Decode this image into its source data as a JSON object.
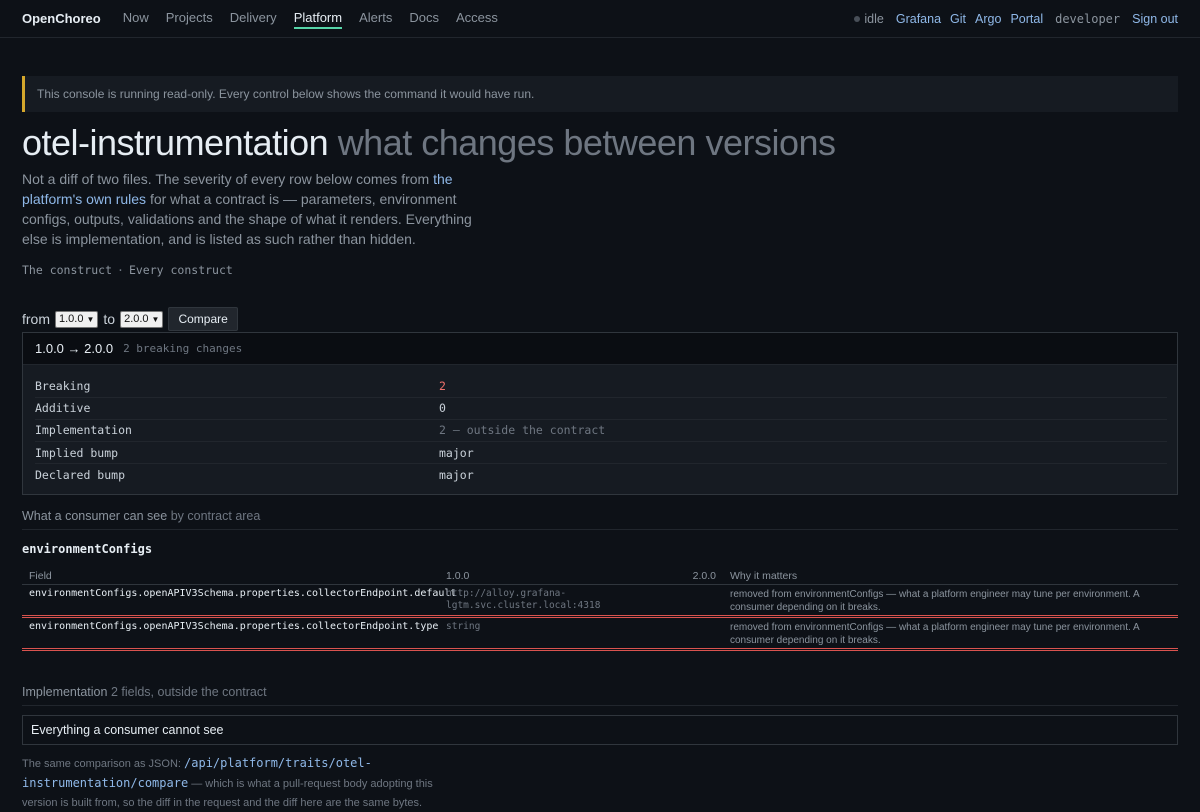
{
  "nav": {
    "brand": "OpenChoreo",
    "links": [
      "Now",
      "Projects",
      "Delivery",
      "Platform",
      "Alerts",
      "Docs",
      "Access"
    ],
    "active": "Platform",
    "status": "idle",
    "external": [
      "Grafana",
      "Git",
      "Argo",
      "Portal"
    ],
    "user": "developer",
    "signout": "Sign out"
  },
  "banner": "This console is running read-only. Every control below shows the command it would have run.",
  "title": {
    "main": "otel-instrumentation",
    "sub": "what changes between versions"
  },
  "intro": {
    "before": "Not a diff of two files. The severity of every row below comes from ",
    "link": "the platform's own rules",
    "after": " for what a contract is — parameters, environment configs, outputs, validations and the shape of what it renders. Everything else is implementation, and is listed as such rather than hidden."
  },
  "crumbs": [
    "The construct",
    "Every construct"
  ],
  "controls": {
    "from_label": "from",
    "from_value": "1.0.0",
    "to_label": "to",
    "to_value": "2.0.0",
    "compare": "Compare"
  },
  "summary": {
    "range": "1.0.0 → 2.0.0",
    "note": "2 breaking changes",
    "rows": [
      {
        "key": "Breaking",
        "value": "2"
      },
      {
        "key": "Additive",
        "value": "0"
      },
      {
        "key": "Implementation",
        "value": "2 — outside the contract"
      },
      {
        "key": "Implied bump",
        "value": "major"
      },
      {
        "key": "Declared bump",
        "value": "major"
      }
    ]
  },
  "consumer": {
    "label": "What a consumer can see",
    "dim": "by contract area"
  },
  "area": "environmentConfigs",
  "diff": {
    "headers": {
      "field": "Field",
      "v1": "1.0.0",
      "v2": "2.0.0",
      "why": "Why it matters"
    },
    "rows": [
      {
        "field": "environmentConfigs.openAPIV3Schema.properties.collectorEndpoint.default",
        "v1": "http://alloy.grafana-lgtm.svc.cluster.local:4318",
        "v2": "",
        "why": "removed from environmentConfigs — what a platform engineer may tune per environment. A consumer depending on it breaks."
      },
      {
        "field": "environmentConfigs.openAPIV3Schema.properties.collectorEndpoint.type",
        "v1": "string",
        "v2": "",
        "why": "removed from environmentConfigs — what a platform engineer may tune per environment. A consumer depending on it breaks."
      }
    ]
  },
  "implementation": {
    "label": "Implementation",
    "dim": "2 fields, outside the contract",
    "details": "Everything a consumer cannot see"
  },
  "footer": {
    "before": "The same comparison as JSON: ",
    "path": "/api/platform/traits/otel-instrumentation/compare",
    "after": " — which is what a pull-request body adopting this version is built from, so the diff in the request and the diff here are the same bytes."
  },
  "colors": {
    "accent": "#56d4a8",
    "warning": "#d4a72c",
    "breaking": "#f0716b",
    "link": "#8fb8e8"
  }
}
